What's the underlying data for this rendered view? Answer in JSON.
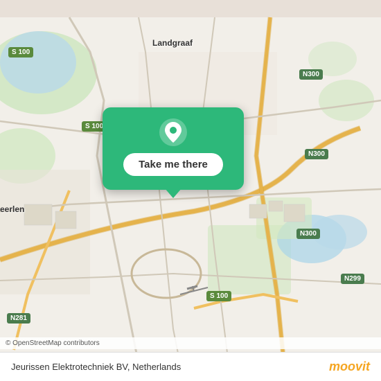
{
  "map": {
    "attribution": "© OpenStreetMap contributors",
    "location_name": "Jeurissen Elektrotechniek BV, Netherlands",
    "city_label": "Landgraaf",
    "city_label_2": "eerlen",
    "road_labels": [
      {
        "text": "N300",
        "style": "road-n"
      },
      {
        "text": "S 100",
        "style": "road-s"
      },
      {
        "text": "N281",
        "style": "road-n"
      },
      {
        "text": "N299",
        "style": "road-n"
      }
    ]
  },
  "popup": {
    "button_label": "Take me there"
  },
  "footer": {
    "moovit_brand": "moovit"
  }
}
